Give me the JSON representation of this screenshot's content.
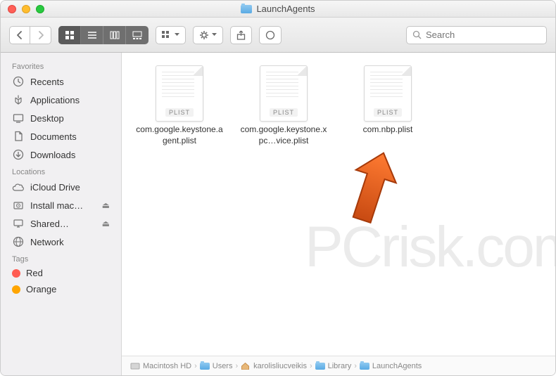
{
  "window": {
    "title": "LaunchAgents"
  },
  "search": {
    "placeholder": "Search"
  },
  "sidebar": {
    "sections": [
      {
        "title": "Favorites",
        "items": [
          {
            "label": "Recents",
            "icon": "clock"
          },
          {
            "label": "Applications",
            "icon": "apps"
          },
          {
            "label": "Desktop",
            "icon": "desktop"
          },
          {
            "label": "Documents",
            "icon": "documents"
          },
          {
            "label": "Downloads",
            "icon": "downloads"
          }
        ]
      },
      {
        "title": "Locations",
        "items": [
          {
            "label": "iCloud Drive",
            "icon": "cloud"
          },
          {
            "label": "Install mac…",
            "icon": "disk",
            "eject": true
          },
          {
            "label": "Shared…",
            "icon": "display",
            "eject": true
          },
          {
            "label": "Network",
            "icon": "network"
          }
        ]
      },
      {
        "title": "Tags",
        "items": [
          {
            "label": "Red",
            "tag_color": "#ff5c52"
          },
          {
            "label": "Orange",
            "tag_color": "#ffa500"
          }
        ]
      }
    ]
  },
  "files": [
    {
      "name": "com.google.keystone.agent.plist",
      "type": "PLIST"
    },
    {
      "name": "com.google.keystone.xpc…vice.plist",
      "type": "PLIST"
    },
    {
      "name": "com.nbp.plist",
      "type": "PLIST"
    }
  ],
  "path": [
    {
      "label": "Macintosh HD",
      "icon": "disk"
    },
    {
      "label": "Users",
      "icon": "folder"
    },
    {
      "label": "karolisliucveikis",
      "icon": "home"
    },
    {
      "label": "Library",
      "icon": "folder"
    },
    {
      "label": "LaunchAgents",
      "icon": "folder"
    }
  ],
  "watermark": "PCrisk.com"
}
